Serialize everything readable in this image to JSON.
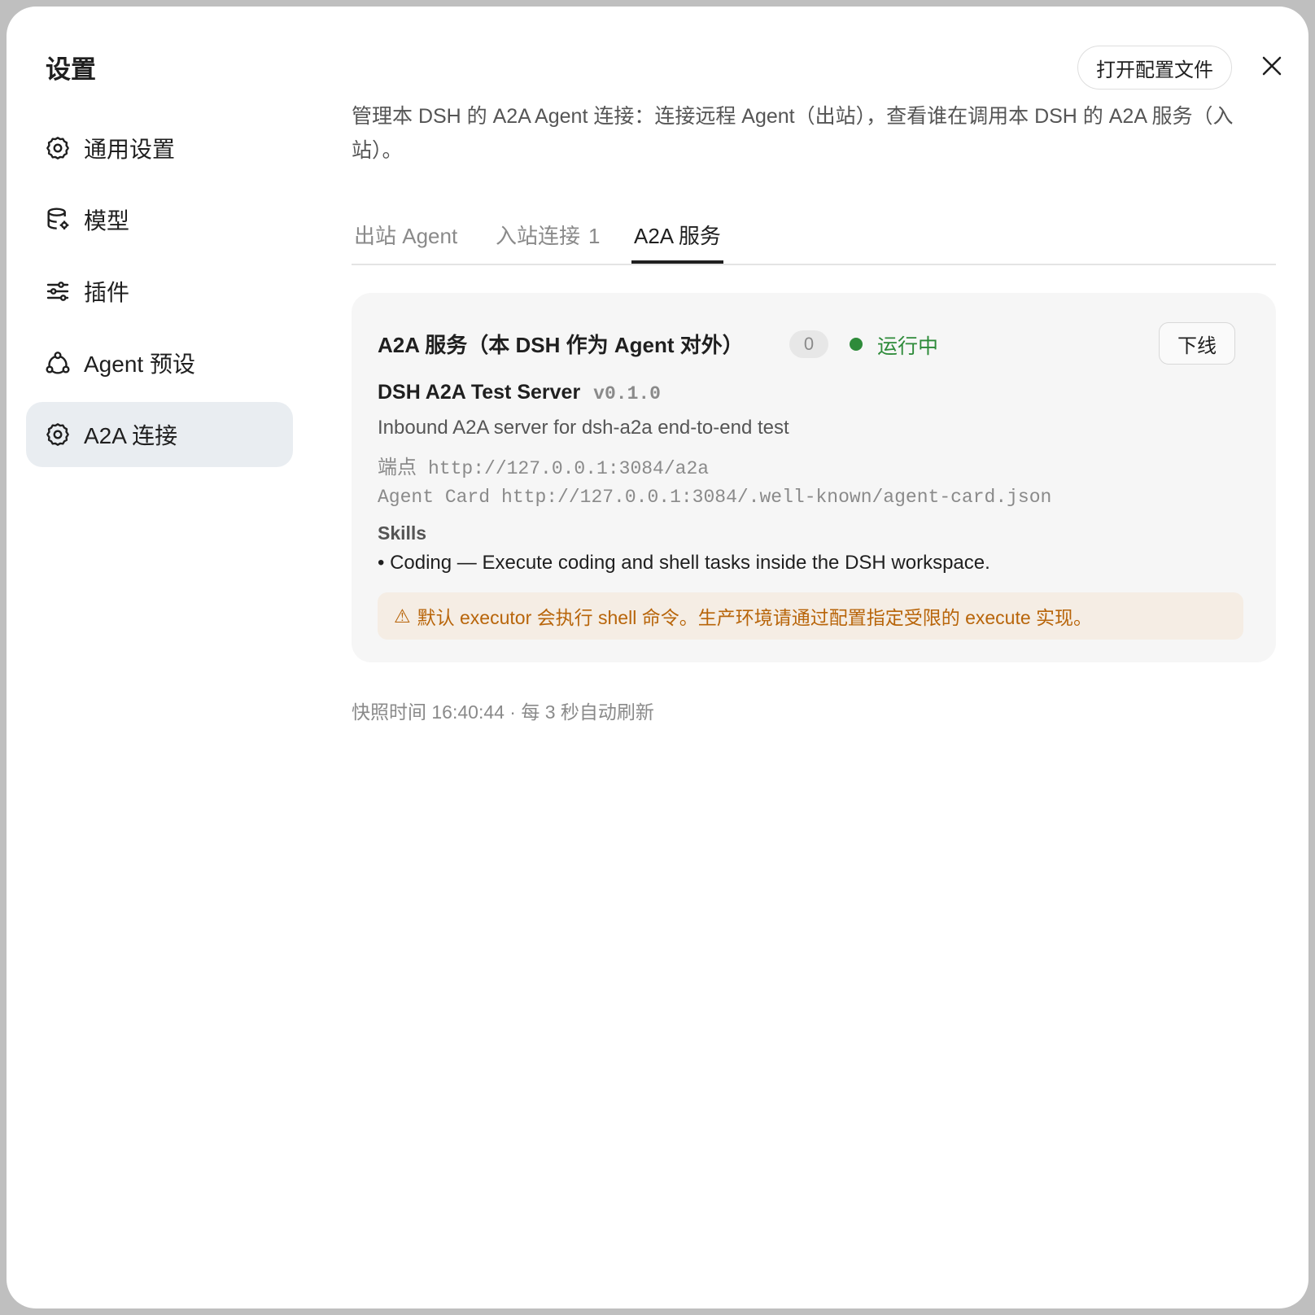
{
  "sidebar": {
    "title": "设置",
    "items": [
      {
        "label": "通用设置",
        "icon": "gear-icon"
      },
      {
        "label": "模型",
        "icon": "database-icon"
      },
      {
        "label": "插件",
        "icon": "sliders-icon"
      },
      {
        "label": "Agent 预设",
        "icon": "agent-icon"
      },
      {
        "label": "A2A 连接",
        "icon": "gear-icon",
        "active": true
      }
    ]
  },
  "header": {
    "open_config_label": "打开配置文件",
    "close_icon": "close-icon"
  },
  "main": {
    "description": "管理本 DSH 的 A2A Agent 连接：连接远程 Agent（出站），查看谁在调用本 DSH 的 A2A 服务（入站）。",
    "tabs": [
      {
        "label": "出站 Agent",
        "count": ""
      },
      {
        "label": "入站连接",
        "count": "1"
      },
      {
        "label": "A2A 服务",
        "count": "",
        "active": true
      }
    ],
    "service_card": {
      "title": "A2A 服务（本 DSH 作为 Agent 对外）",
      "badge": "0",
      "status": "运行中",
      "status_color": "#2e8b3a",
      "offline_label": "下线",
      "server_name": "DSH A2A Test Server",
      "server_version": "v0.1.0",
      "server_description": "Inbound A2A server for dsh-a2a end-to-end test",
      "endpoint_label": "端点",
      "endpoint_url": "http://127.0.0.1:3084/a2a",
      "agent_card_label": "Agent Card",
      "agent_card_url": "http://127.0.0.1:3084/.well-known/agent-card.json",
      "skills_title": "Skills",
      "skills": [
        "• Coding — Execute coding and shell tasks inside the DSH workspace."
      ],
      "warning_icon": "⚠",
      "warning": "默认 executor 会执行 shell 命令。生产环境请通过配置指定受限的 execute 实现。",
      "warning_color": "#b8650a"
    },
    "snapshot": "快照时间 16:40:44 · 每 3 秒自动刷新"
  }
}
